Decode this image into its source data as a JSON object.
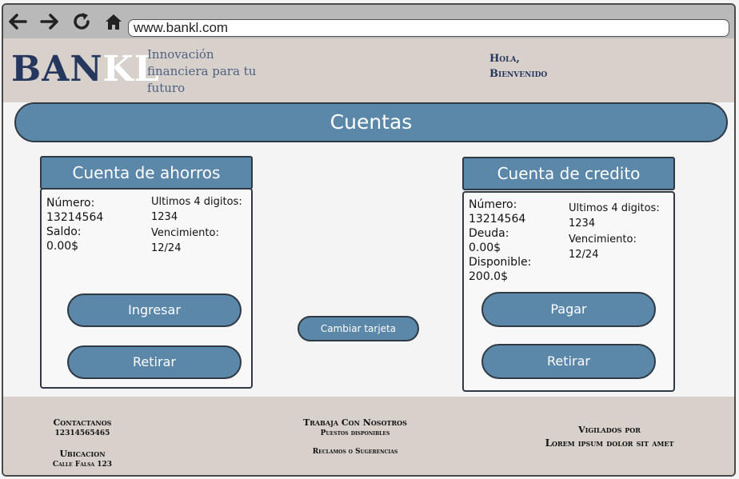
{
  "browser": {
    "url": "www.bankl.com",
    "icons": [
      "back-arrow-icon",
      "forward-arrow-icon",
      "reload-icon",
      "home-icon"
    ]
  },
  "header": {
    "logo_part1": "BAN",
    "logo_part2": "KL",
    "tagline": "Innovación financiera para tu futuro",
    "greeting_line1": "Hola,",
    "greeting_line2": "Bienvenido"
  },
  "main": {
    "title": "Cuentas",
    "change_card_label": "Cambiar tarjeta"
  },
  "savings": {
    "title": "Cuenta de ahorros",
    "number_label": "Número:",
    "number_value": "13214564",
    "balance_label": "Saldo:",
    "balance_value": "0.00$",
    "last4_label": "Ultimos 4 digitos:",
    "last4_value": "1234",
    "expiry_label": "Vencimiento:",
    "expiry_value": "12/24",
    "deposit_label": "Ingresar",
    "withdraw_label": "Retirar"
  },
  "credit": {
    "title": "Cuenta de credito",
    "number_label": "Número:",
    "number_value": "13214564",
    "debt_label": "Deuda:",
    "debt_value": "0.00$",
    "available_label": "Disponible:",
    "available_value": "200.0$",
    "last4_label": "Ultimos 4 digitos:",
    "last4_value": "1234",
    "expiry_label": "Vencimiento:",
    "expiry_value": "12/24",
    "pay_label": "Pagar",
    "withdraw_label": "Retirar"
  },
  "footer": {
    "contact_title": "Contactanos",
    "contact_phone": "12314565465",
    "location_title": "Ubicacion",
    "location_address": "Calle Falsa 123",
    "jobs_title": "Trabaja Con Nosotros",
    "jobs_sub": "Puestos disponibles",
    "claims": "Reclamos o Sugerencias",
    "supervised_title": "Vigilados por",
    "supervised_by": "Lorem ipsum dolor sit amet"
  },
  "colors": {
    "accent": "#5b87a8",
    "navy": "#26375e",
    "header_bg": "#d7d0cb",
    "toolbar_bg": "#b9b9b9"
  }
}
